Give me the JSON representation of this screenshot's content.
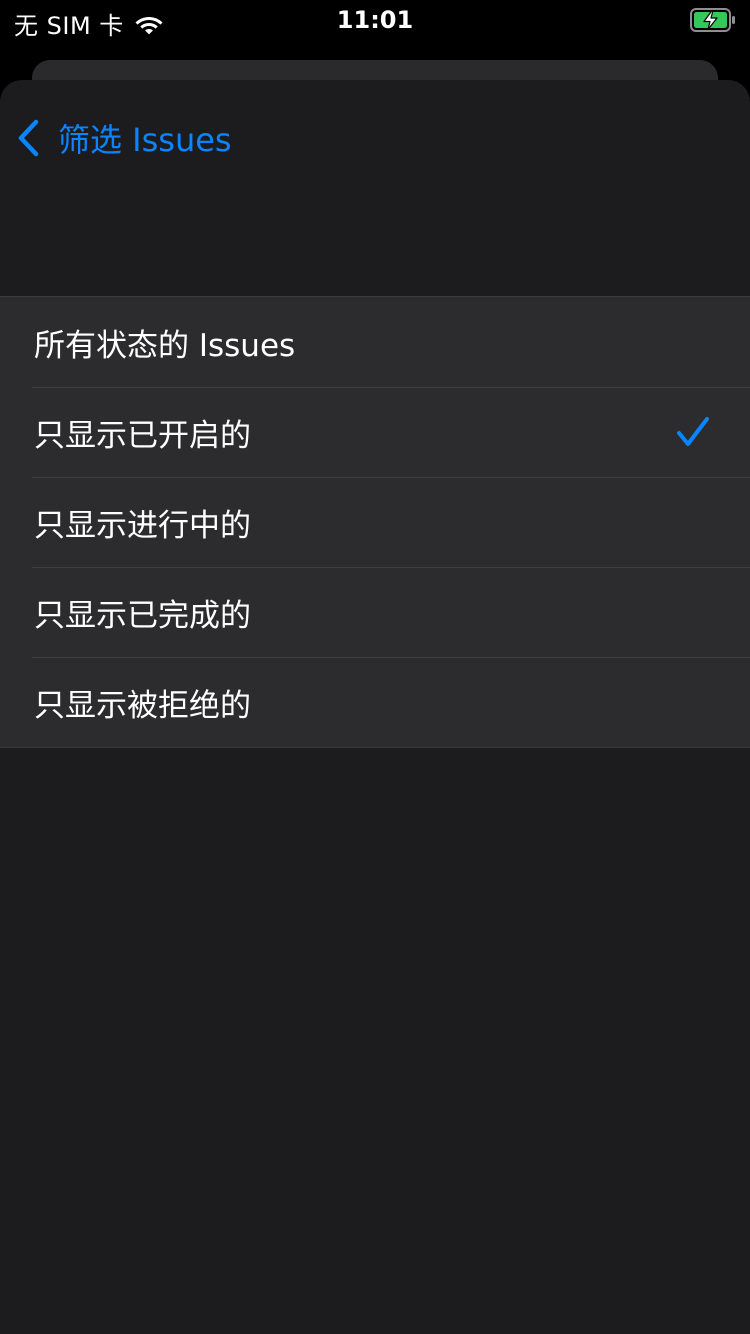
{
  "status_bar": {
    "carrier": "无 SIM 卡",
    "time": "11:01",
    "wifi_icon": "wifi-icon",
    "battery_icon": "battery-charging-icon",
    "battery_color": "#34c759"
  },
  "nav": {
    "back_label": "筛选 Issues",
    "back_icon": "chevron-left-icon",
    "accent_color": "#0a84ff"
  },
  "filter_options": [
    {
      "label": "所有状态的 Issues",
      "selected": false
    },
    {
      "label": "只显示已开启的",
      "selected": true
    },
    {
      "label": "只显示进行中的",
      "selected": false
    },
    {
      "label": "只显示已完成的",
      "selected": false
    },
    {
      "label": "只显示被拒绝的",
      "selected": false
    }
  ]
}
